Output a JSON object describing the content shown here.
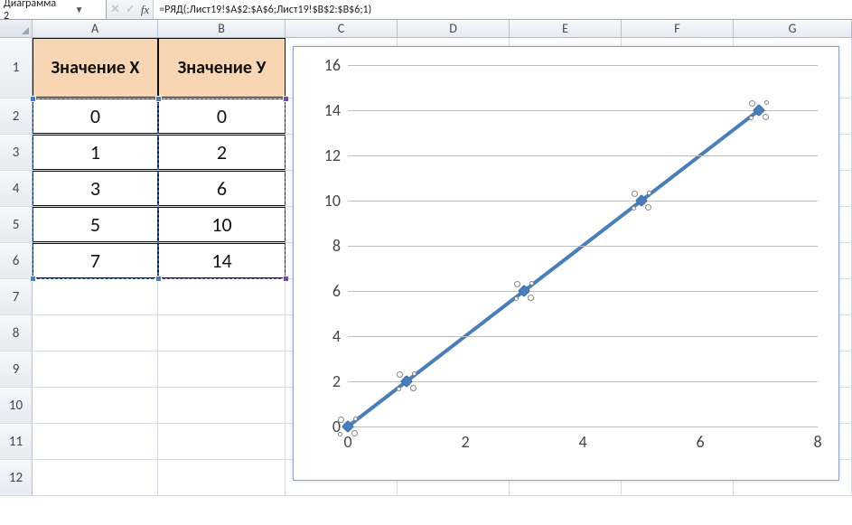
{
  "formula_bar": {
    "namebox": "Диаграмма 2",
    "formula": "=РЯД(;Лист19!$A$2:$A$6;Лист19!$B$2:$B$6;1)"
  },
  "columns": [
    "A",
    "B",
    "C",
    "D",
    "E",
    "F",
    "G"
  ],
  "rows": [
    "1",
    "2",
    "3",
    "4",
    "5",
    "6",
    "7",
    "8",
    "9",
    "10",
    "11",
    "12"
  ],
  "table": {
    "header_x": "Значение Х",
    "header_y": "Значение У",
    "data": [
      {
        "x": "0",
        "y": "0"
      },
      {
        "x": "1",
        "y": "2"
      },
      {
        "x": "3",
        "y": "6"
      },
      {
        "x": "5",
        "y": "10"
      },
      {
        "x": "7",
        "y": "14"
      }
    ]
  },
  "chart_data": {
    "type": "line",
    "x": [
      0,
      1,
      3,
      5,
      7
    ],
    "y": [
      0,
      2,
      6,
      10,
      14
    ],
    "xlim": [
      0,
      8
    ],
    "ylim": [
      0,
      16
    ],
    "x_ticks": [
      0,
      2,
      4,
      6,
      8
    ],
    "y_ticks": [
      0,
      2,
      4,
      6,
      8,
      10,
      12,
      14,
      16
    ],
    "markers": true,
    "grid_h": true,
    "series_color": "#4a7ebb"
  }
}
